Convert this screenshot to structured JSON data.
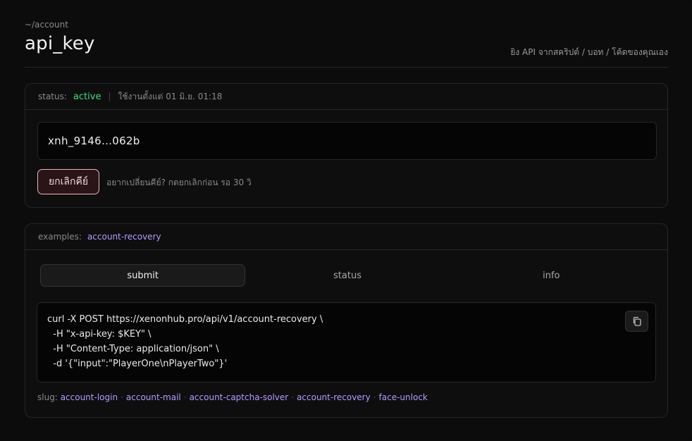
{
  "header": {
    "breadcrumb": "~/account",
    "title": "api_key",
    "subtitle": "ยิง API จากสคริปต์ / บอท / โค้ดของคุณเอง"
  },
  "status_card": {
    "status_label": "status:",
    "status_value": "active",
    "separator": "|",
    "since_text": "ใช้งานตั้งแต่ 01 มิ.ย. 01:18",
    "key_masked": "xnh_9146…062b",
    "revoke_label": "ยกเลิกคีย์",
    "revoke_hint": "อยากเปลี่ยนคีย์? กดยกเลิกก่อน รอ 30 วิ"
  },
  "examples_card": {
    "label": "examples:",
    "current": "account-recovery",
    "tabs": [
      {
        "label": "submit",
        "active": true
      },
      {
        "label": "status",
        "active": false
      },
      {
        "label": "info",
        "active": false
      }
    ],
    "code_lines": [
      "curl -X POST https://xenonhub.pro/api/v1/account-recovery \\",
      "  -H \"x-api-key: $KEY\" \\",
      "  -H \"Content-Type: application/json\" \\",
      "  -d '{\"input\":\"PlayerOne\\nPlayerTwo\"}'"
    ],
    "copy_icon": "copy-icon",
    "slug_label": "slug:",
    "slugs": [
      "account-login",
      "account-mail",
      "account-captcha-solver",
      "account-recovery",
      "face-unlock"
    ],
    "slug_separator": "·"
  },
  "colors": {
    "active": "#3ddc84",
    "link": "#b39cff",
    "danger_border": "#e7b7c0"
  }
}
